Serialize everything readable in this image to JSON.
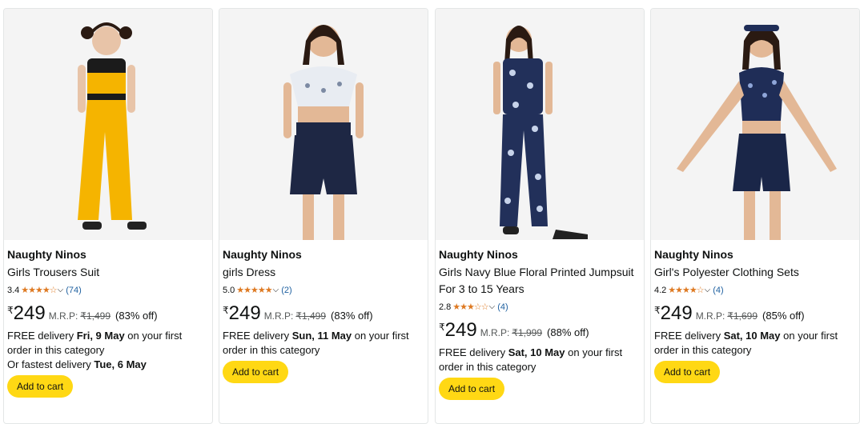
{
  "products": [
    {
      "brand": "Naughty Ninos",
      "title": "Girls Trousers Suit",
      "rating": "3.4",
      "stars": "★★★★☆",
      "reviews": "(74)",
      "currency": "₹",
      "price": "249",
      "mrp_label": "M.R.P:",
      "mrp": "₹1,499",
      "discount": "(83% off)",
      "delivery_prefix": "FREE delivery ",
      "delivery_date": "Fri, 9 May",
      "delivery_suffix": " on your first order in this category",
      "fastest_prefix": "Or fastest delivery ",
      "fastest_date": "Tue, 6 May",
      "cart_label": "Add to cart",
      "colors": {
        "top": "#f5b400",
        "accent": "#1b1b1b",
        "bottom": "#f5b400"
      }
    },
    {
      "brand": "Naughty Ninos",
      "title": "girls Dress",
      "rating": "5.0",
      "stars": "★★★★★",
      "reviews": "(2)",
      "currency": "₹",
      "price": "249",
      "mrp_label": "M.R.P:",
      "mrp": "₹1,499",
      "discount": "(83% off)",
      "delivery_prefix": "FREE delivery ",
      "delivery_date": "Sun, 11 May",
      "delivery_suffix": " on your first order in this category",
      "cart_label": "Add to cart",
      "colors": {
        "top": "#e8ecf2",
        "accent": "#7c8aa3",
        "bottom": "#1e2744"
      }
    },
    {
      "brand": "Naughty Ninos",
      "title": "Girls Navy Blue Floral Printed Jumpsuit For 3 to 15 Years",
      "rating": "2.8",
      "stars": "★★★☆☆",
      "reviews": "(4)",
      "currency": "₹",
      "price": "249",
      "mrp_label": "M.R.P:",
      "mrp": "₹1,999",
      "discount": "(88% off)",
      "delivery_prefix": "FREE delivery ",
      "delivery_date": "Sat, 10 May",
      "delivery_suffix": " on your first order in this category",
      "cart_label": "Add to cart",
      "colors": {
        "top": "#22305a",
        "accent": "#c7d3ea",
        "bottom": "#22305a"
      }
    },
    {
      "brand": "Naughty Ninos",
      "title": "Girl's Polyester Clothing Sets",
      "rating": "4.2",
      "stars": "★★★★☆",
      "reviews": "(4)",
      "currency": "₹",
      "price": "249",
      "mrp_label": "M.R.P:",
      "mrp": "₹1,699",
      "discount": "(85% off)",
      "delivery_prefix": "FREE delivery ",
      "delivery_date": "Sat, 10 May",
      "delivery_suffix": " on your first order in this category",
      "cart_label": "Add to cart",
      "colors": {
        "top": "#1f2d57",
        "accent": "#8fa6d8",
        "bottom": "#1a2648"
      }
    }
  ]
}
